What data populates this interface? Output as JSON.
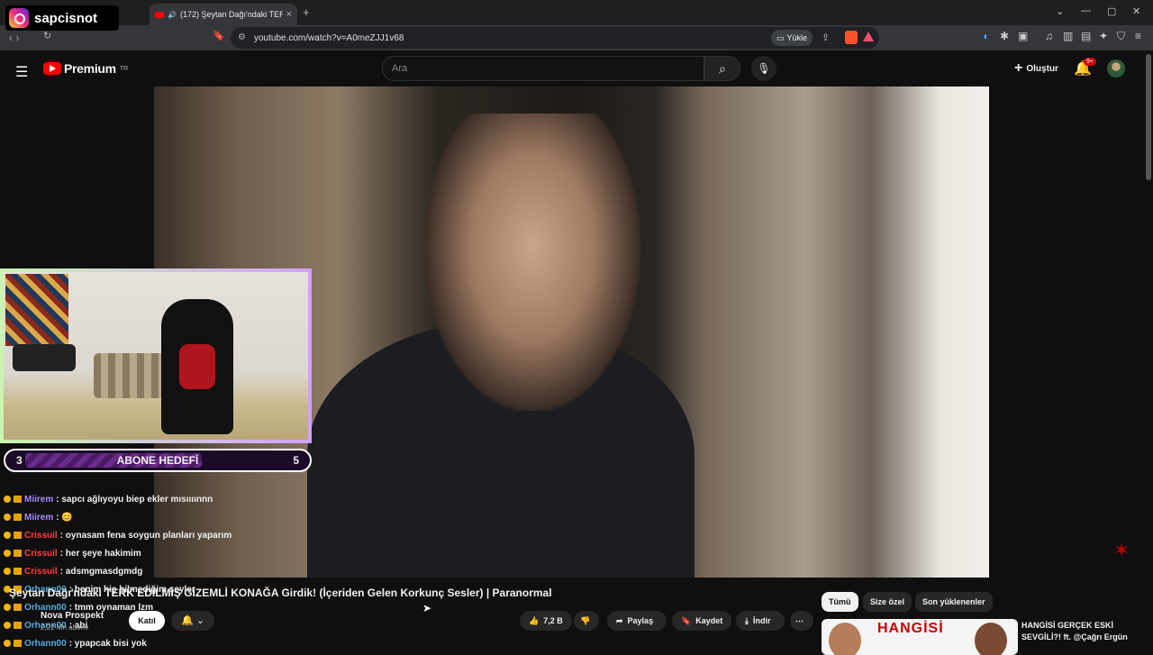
{
  "browser": {
    "tab_title": "(172) Şeytan Dağı'ndaki TERK",
    "url": "youtube.com/watch?v=A0meZJJ1v68",
    "upload_label": "Yükle"
  },
  "overlay": {
    "brand": "sapcisnot"
  },
  "youtube": {
    "logo_text": "Premium",
    "logo_sup": "TR",
    "search_placeholder": "Ara",
    "create_label": "Oluştur",
    "notif_count": "9+"
  },
  "stream_goal": {
    "label": "ABONE HEDEFİ",
    "current": "3",
    "target": "5",
    "progress": 0.6
  },
  "chat": [
    {
      "user": "Miirem",
      "text": ": sapcı ağlıyoyu biep ekler mısıııınnn",
      "color": "purple"
    },
    {
      "user": "Miirem",
      "text": ": 😊",
      "color": "purple"
    },
    {
      "user": "Crissuil",
      "text": ": oynasam fena soygun planları yaparım",
      "color": "red"
    },
    {
      "user": "Crissuil",
      "text": ": her şeye hakimim",
      "color": "red"
    },
    {
      "user": "Crissuil",
      "text": ": adsmgmasdgmdg",
      "color": "red"
    },
    {
      "user": "Orhann00",
      "text": ": benim hiç bilmediğim şeyler",
      "color": "teal"
    },
    {
      "user": "Orhann00",
      "text": ": tmm oynaman lzm",
      "color": "teal"
    },
    {
      "user": "Orhann00",
      "text": ": abi",
      "color": "teal"
    },
    {
      "user": "Orhann00",
      "text": ": ypapcak bisi yok",
      "color": "teal"
    }
  ],
  "video": {
    "title": "Şeytan Dağı'ndaki TERK EDİLMİŞ GİZEMLİ KONAĞA Girdik! (İçeriden Gelen Korkunç Sesler) | Paranormal",
    "channel": "Nova Prospekt",
    "subscribers": "2,22 Mn abone",
    "join_label": "Katıl",
    "likes": "7,2 B",
    "share_label": "Paylaş",
    "save_label": "Kaydet",
    "download_label": "İndir"
  },
  "recommendations": {
    "chips": [
      "Tümü",
      "Size özel",
      "Son yüklenenler"
    ],
    "first": {
      "thumb_text": "HANGİSİ",
      "title": "HANGİSİ GERÇEK ESKİ SEVGİLİ?! ft. @Çağrı Ergün"
    }
  }
}
